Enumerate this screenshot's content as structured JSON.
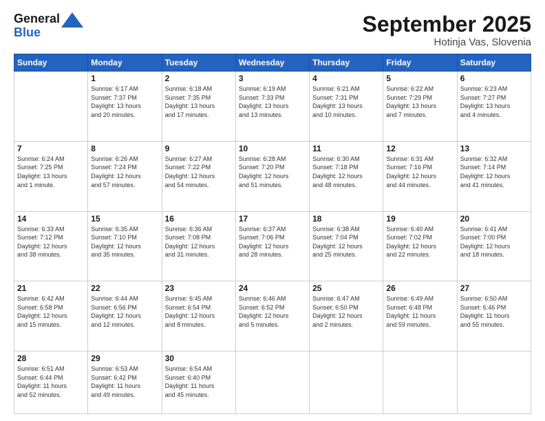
{
  "header": {
    "logo_general": "General",
    "logo_blue": "Blue",
    "month_title": "September 2025",
    "location": "Hotinja Vas, Slovenia"
  },
  "days_of_week": [
    "Sunday",
    "Monday",
    "Tuesday",
    "Wednesday",
    "Thursday",
    "Friday",
    "Saturday"
  ],
  "weeks": [
    [
      {
        "day": "",
        "info": ""
      },
      {
        "day": "1",
        "info": "Sunrise: 6:17 AM\nSunset: 7:37 PM\nDaylight: 13 hours\nand 20 minutes."
      },
      {
        "day": "2",
        "info": "Sunrise: 6:18 AM\nSunset: 7:35 PM\nDaylight: 13 hours\nand 17 minutes."
      },
      {
        "day": "3",
        "info": "Sunrise: 6:19 AM\nSunset: 7:33 PM\nDaylight: 13 hours\nand 13 minutes."
      },
      {
        "day": "4",
        "info": "Sunrise: 6:21 AM\nSunset: 7:31 PM\nDaylight: 13 hours\nand 10 minutes."
      },
      {
        "day": "5",
        "info": "Sunrise: 6:22 AM\nSunset: 7:29 PM\nDaylight: 13 hours\nand 7 minutes."
      },
      {
        "day": "6",
        "info": "Sunrise: 6:23 AM\nSunset: 7:27 PM\nDaylight: 13 hours\nand 4 minutes."
      }
    ],
    [
      {
        "day": "7",
        "info": "Sunrise: 6:24 AM\nSunset: 7:25 PM\nDaylight: 13 hours\nand 1 minute."
      },
      {
        "day": "8",
        "info": "Sunrise: 6:26 AM\nSunset: 7:24 PM\nDaylight: 12 hours\nand 57 minutes."
      },
      {
        "day": "9",
        "info": "Sunrise: 6:27 AM\nSunset: 7:22 PM\nDaylight: 12 hours\nand 54 minutes."
      },
      {
        "day": "10",
        "info": "Sunrise: 6:28 AM\nSunset: 7:20 PM\nDaylight: 12 hours\nand 51 minutes."
      },
      {
        "day": "11",
        "info": "Sunrise: 6:30 AM\nSunset: 7:18 PM\nDaylight: 12 hours\nand 48 minutes."
      },
      {
        "day": "12",
        "info": "Sunrise: 6:31 AM\nSunset: 7:16 PM\nDaylight: 12 hours\nand 44 minutes."
      },
      {
        "day": "13",
        "info": "Sunrise: 6:32 AM\nSunset: 7:14 PM\nDaylight: 12 hours\nand 41 minutes."
      }
    ],
    [
      {
        "day": "14",
        "info": "Sunrise: 6:33 AM\nSunset: 7:12 PM\nDaylight: 12 hours\nand 38 minutes."
      },
      {
        "day": "15",
        "info": "Sunrise: 6:35 AM\nSunset: 7:10 PM\nDaylight: 12 hours\nand 35 minutes."
      },
      {
        "day": "16",
        "info": "Sunrise: 6:36 AM\nSunset: 7:08 PM\nDaylight: 12 hours\nand 31 minutes."
      },
      {
        "day": "17",
        "info": "Sunrise: 6:37 AM\nSunset: 7:06 PM\nDaylight: 12 hours\nand 28 minutes."
      },
      {
        "day": "18",
        "info": "Sunrise: 6:38 AM\nSunset: 7:04 PM\nDaylight: 12 hours\nand 25 minutes."
      },
      {
        "day": "19",
        "info": "Sunrise: 6:40 AM\nSunset: 7:02 PM\nDaylight: 12 hours\nand 22 minutes."
      },
      {
        "day": "20",
        "info": "Sunrise: 6:41 AM\nSunset: 7:00 PM\nDaylight: 12 hours\nand 18 minutes."
      }
    ],
    [
      {
        "day": "21",
        "info": "Sunrise: 6:42 AM\nSunset: 6:58 PM\nDaylight: 12 hours\nand 15 minutes."
      },
      {
        "day": "22",
        "info": "Sunrise: 6:44 AM\nSunset: 6:56 PM\nDaylight: 12 hours\nand 12 minutes."
      },
      {
        "day": "23",
        "info": "Sunrise: 6:45 AM\nSunset: 6:54 PM\nDaylight: 12 hours\nand 8 minutes."
      },
      {
        "day": "24",
        "info": "Sunrise: 6:46 AM\nSunset: 6:52 PM\nDaylight: 12 hours\nand 5 minutes."
      },
      {
        "day": "25",
        "info": "Sunrise: 6:47 AM\nSunset: 6:50 PM\nDaylight: 12 hours\nand 2 minutes."
      },
      {
        "day": "26",
        "info": "Sunrise: 6:49 AM\nSunset: 6:48 PM\nDaylight: 11 hours\nand 59 minutes."
      },
      {
        "day": "27",
        "info": "Sunrise: 6:50 AM\nSunset: 6:46 PM\nDaylight: 11 hours\nand 55 minutes."
      }
    ],
    [
      {
        "day": "28",
        "info": "Sunrise: 6:51 AM\nSunset: 6:44 PM\nDaylight: 11 hours\nand 52 minutes."
      },
      {
        "day": "29",
        "info": "Sunrise: 6:53 AM\nSunset: 6:42 PM\nDaylight: 11 hours\nand 49 minutes."
      },
      {
        "day": "30",
        "info": "Sunrise: 6:54 AM\nSunset: 6:40 PM\nDaylight: 11 hours\nand 45 minutes."
      },
      {
        "day": "",
        "info": ""
      },
      {
        "day": "",
        "info": ""
      },
      {
        "day": "",
        "info": ""
      },
      {
        "day": "",
        "info": ""
      }
    ]
  ]
}
